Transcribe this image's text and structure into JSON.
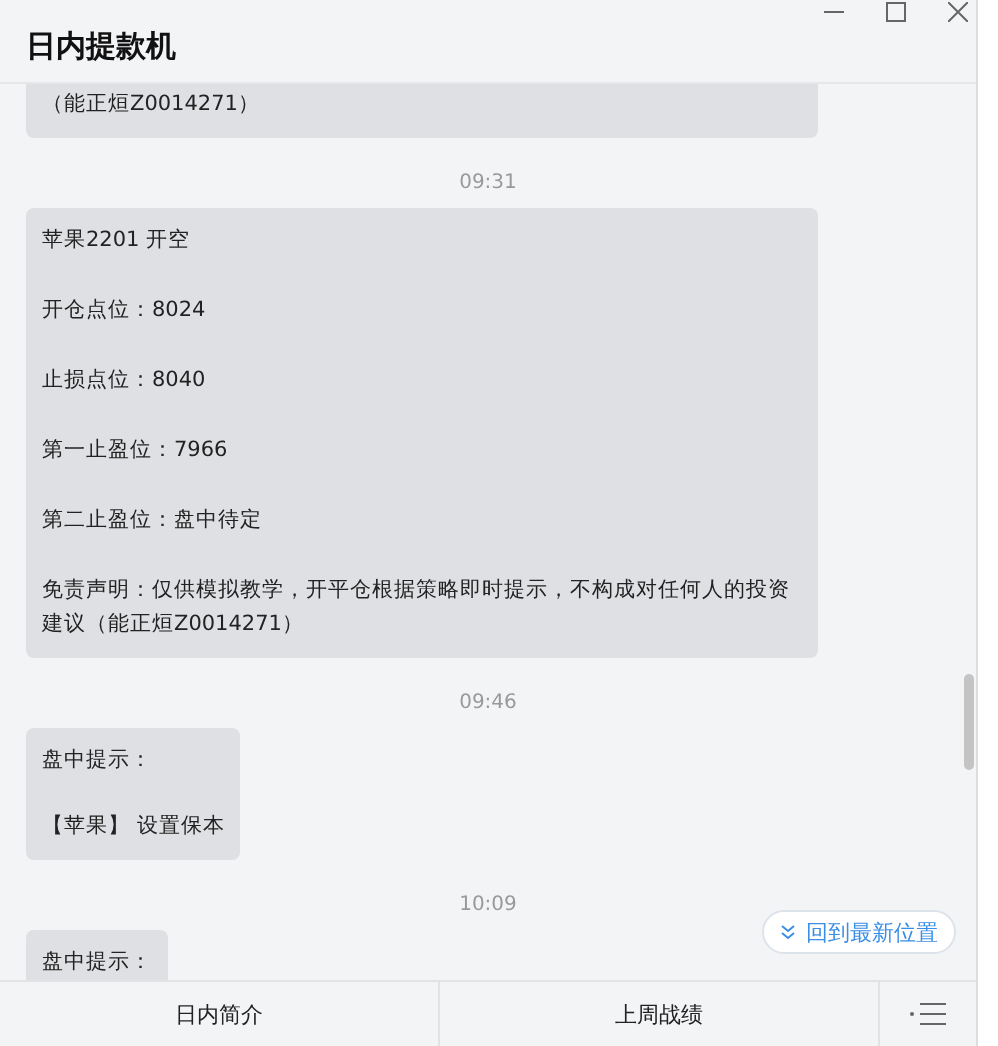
{
  "window": {
    "title": "日内提款机"
  },
  "messages": [
    {
      "kind": "message",
      "lines": [
        "（能正烜Z0014271）"
      ]
    },
    {
      "kind": "time",
      "text": "09:31"
    },
    {
      "kind": "message",
      "lines": [
        "苹果2201 开空",
        "开仓点位：8024",
        "止损点位：8040",
        "第一止盈位：7966",
        "第二止盈位：盘中待定",
        "免责声明：仅供模拟教学，开平仓根据策略即时提示，不构成对任何人的投资建议（能正烜Z0014271）"
      ]
    },
    {
      "kind": "time",
      "text": "09:46"
    },
    {
      "kind": "message",
      "lines": [
        "盘中提示：",
        "【苹果】 设置保本"
      ]
    },
    {
      "kind": "time",
      "text": "10:09"
    },
    {
      "kind": "message",
      "lines": [
        "盘中提示："
      ]
    }
  ],
  "jump_button": {
    "label": "回到最新位置"
  },
  "bottom_tabs": [
    "日内简介",
    "上周战绩"
  ]
}
